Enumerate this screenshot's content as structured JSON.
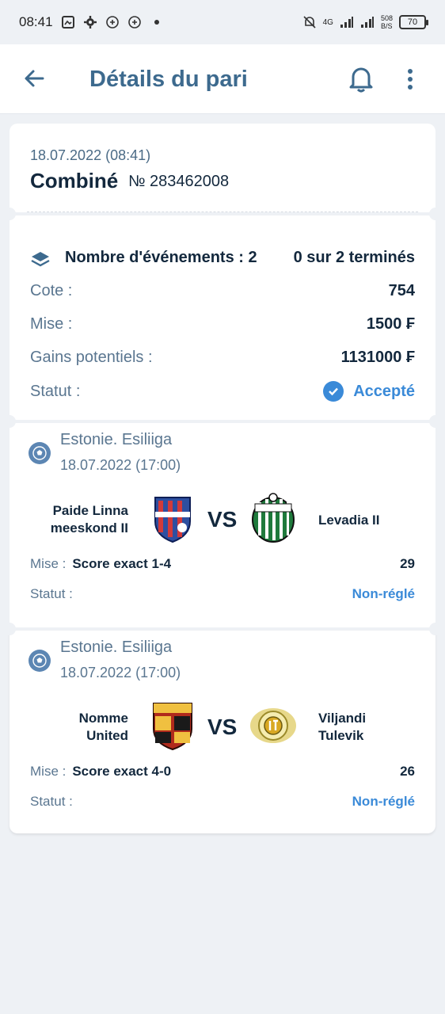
{
  "status_bar": {
    "time": "08:41",
    "network": "4G",
    "speed": "508",
    "speed_unit": "B/S",
    "battery": "70"
  },
  "header": {
    "title": "Détails du pari",
    "icons": [
      "back-arrow-icon",
      "bell-icon",
      "more-vertical-icon"
    ]
  },
  "bet": {
    "date": "18.07.2022 (08:41)",
    "type": "Combiné",
    "number": "№ 283462008"
  },
  "summary": {
    "events_label": "Nombre d'événements : 2",
    "events_done": "0 sur 2 terminés",
    "odds_label": "Cote :",
    "odds_value": "754",
    "stake_label": "Mise :",
    "stake_value": "1500 ₣",
    "potential_label": "Gains potentiels :",
    "potential_value": "1131000 ₣",
    "status_label": "Statut :",
    "status_value": "Accepté"
  },
  "events": [
    {
      "league": "Estonie. Esiliiga",
      "date": "18.07.2022 (17:00)",
      "home_line1": "Paide Linna",
      "home_line2": "meeskond II",
      "vs": "VS",
      "away_line1": "Levadia II",
      "away_line2": "",
      "stake_label": "Mise :",
      "pick": "Score exact 1-4",
      "odds": "29",
      "status_label": "Statut :",
      "status_value": "Non-réglé"
    },
    {
      "league": "Estonie. Esiliiga",
      "date": "18.07.2022 (17:00)",
      "home_line1": "Nomme",
      "home_line2": "United",
      "vs": "VS",
      "away_line1": "Viljandi",
      "away_line2": "Tulevik",
      "stake_label": "Mise :",
      "pick": "Score exact 4-0",
      "odds": "26",
      "status_label": "Statut :",
      "status_value": "Non-réglé"
    }
  ],
  "colors": {
    "accent": "#3a8ad8",
    "title": "#3d6a8e",
    "text_dark": "#13283d",
    "text_muted": "#5a7690",
    "background": "#eef1f5"
  }
}
